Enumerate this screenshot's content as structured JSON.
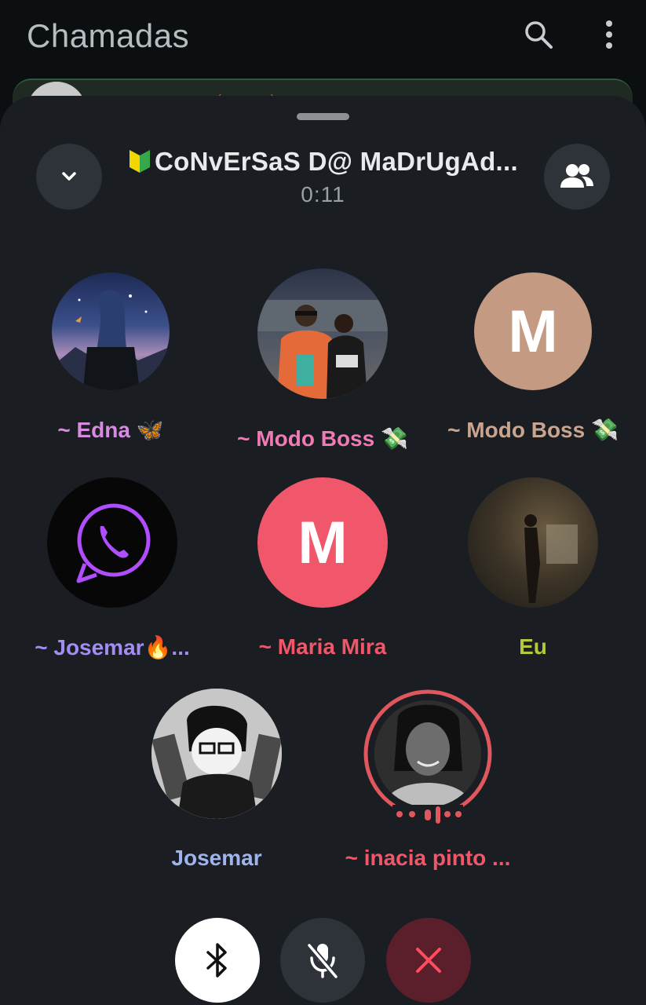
{
  "background_app": {
    "title": "Chamadas",
    "search_icon": "search-icon",
    "more_icon": "more-vert-icon",
    "peek_row_text": "♥ ☁ ♪ · · · ( · · · ) ☺ ♥"
  },
  "call": {
    "group_name": "CoNvErSaS D@ MaDrUgAd...",
    "timer": "0:11",
    "participants": [
      {
        "name": "~ Edna 🦋",
        "color": "#d68be0",
        "avatar": "photo"
      },
      {
        "name": "~ Modo Boss 💸",
        "color": "#f07ab4",
        "avatar": "photo"
      },
      {
        "name": "~ Modo Boss 💸",
        "color": "#c9a58f",
        "avatar": "letter",
        "letter": "M",
        "avatar_color": "#c49a82"
      },
      {
        "name": "~ Josemar🔥...",
        "color": "#a48cf5",
        "avatar": "photo"
      },
      {
        "name": "~ Maria Mira",
        "color": "#f0576a",
        "avatar": "letter",
        "letter": "M",
        "avatar_color": "#f0576a"
      },
      {
        "name": "Eu",
        "color": "#b6c73a",
        "avatar": "photo"
      },
      {
        "name": "Josemar",
        "color": "#9fb4ee",
        "avatar": "photo"
      },
      {
        "name": "~ inacia pinto ...",
        "color": "#f0576a",
        "avatar": "photo",
        "speaking": true
      }
    ]
  },
  "controls": {
    "bluetooth": "bluetooth-icon",
    "mic": "mic-off-icon",
    "end": "end-call-icon"
  }
}
